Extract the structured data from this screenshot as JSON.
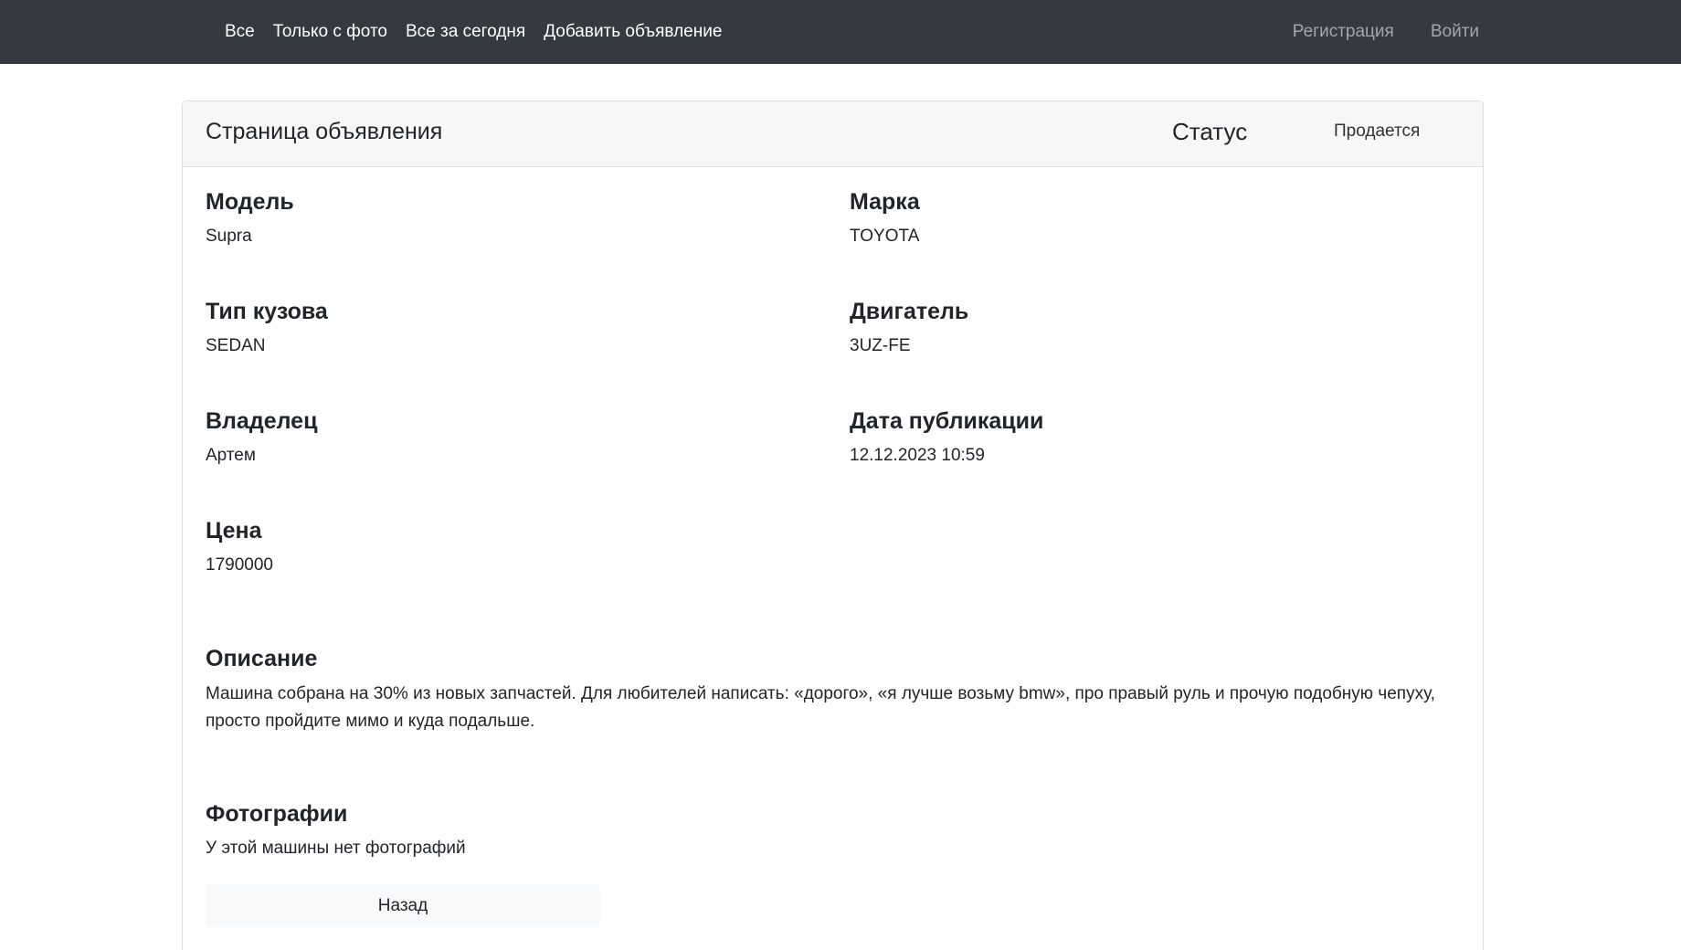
{
  "navbar": {
    "links": [
      "Все",
      "Только с фото",
      "Все за сегодня",
      "Добавить объявление"
    ],
    "auth": {
      "register": "Регистрация",
      "login": "Войти"
    }
  },
  "card": {
    "title": "Страница объявления",
    "status_label": "Статус",
    "status_value": "Продается"
  },
  "fields": {
    "model": {
      "label": "Модель",
      "value": "Supra"
    },
    "brand": {
      "label": "Марка",
      "value": "TOYOTA"
    },
    "body_type": {
      "label": "Тип кузова",
      "value": "SEDAN"
    },
    "engine": {
      "label": "Двигатель",
      "value": "3UZ-FE"
    },
    "owner": {
      "label": "Владелец",
      "value": "Артем"
    },
    "published": {
      "label": "Дата публикации",
      "value": "12.12.2023 10:59"
    },
    "price": {
      "label": "Цена",
      "value": "1790000"
    }
  },
  "description": {
    "label": "Описание",
    "text": "Машина собрана на 30% из новых запчастей. Для любителей написать: «дорого», «я лучше возьму bmw», про правый руль и прочую подобную чепуху, просто пройдите мимо и куда подальше."
  },
  "photos": {
    "label": "Фотографии",
    "empty_text": "У этой машины нет фотографий"
  },
  "back_button": "Назад"
}
